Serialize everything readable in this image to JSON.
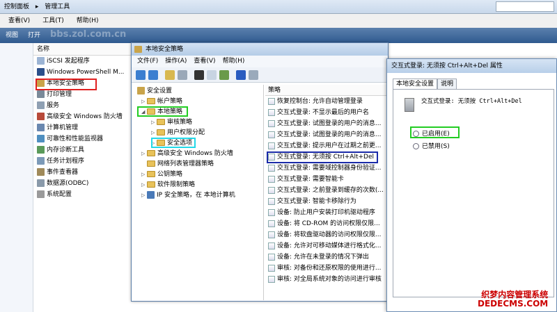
{
  "explorer": {
    "breadcrumb": [
      "控制面板",
      "管理工具"
    ],
    "menu": [
      "查看(V)",
      "工具(T)",
      "帮助(H)"
    ],
    "toolbar": [
      "视图",
      "打开"
    ],
    "watermark": "bbs.zol.com.cn",
    "list_header": "名称",
    "items": [
      "iSCSI 发起程序",
      "Windows PowerShell M...",
      "本地安全策略",
      "打印管理",
      "服务",
      "高级安全 Windows 防火墙",
      "计算机管理",
      "可靠性和性能监视器",
      "内存诊断工具",
      "任务计划程序",
      "事件查看器",
      "数据源(ODBC)",
      "系统配置"
    ]
  },
  "lsp": {
    "title": "本地安全策略",
    "menu": [
      "文件(F)",
      "操作(A)",
      "查看(V)",
      "帮助(H)"
    ],
    "tree": {
      "root": "安全设置",
      "account": "帐户策略",
      "local": "本地策略",
      "audit": "审核策略",
      "rights": "用户权限分配",
      "security": "安全选项",
      "firewall": "高级安全 Windows 防火墙",
      "netlist": "网络列表管理器策略",
      "pubkey": "公钥策略",
      "software": "软件限制策略",
      "ipsec": "IP 安全策略，在 本地计算机"
    },
    "column": "策略",
    "policies": [
      "恢复控制台: 允许自动管理登录",
      "交互式登录: 不显示最后的用户名",
      "交互式登录: 试图登录的用户的消息...",
      "交互式登录: 试图登录的用户的消息...",
      "交互式登录: 提示用户在过期之前更...",
      "交互式登录: 无须按 Ctrl+Alt+Del",
      "交互式登录: 需要域控制器身份验证...",
      "交互式登录: 需要智能卡",
      "交互式登录: 之前登录到缓存的次数(...",
      "交互式登录: 智能卡移除行为",
      "设备: 防止用户安装打印机驱动程序",
      "设备: 将 CD-ROM 的访问权限仅限...",
      "设备: 将软盘驱动器的访问权限仅限...",
      "设备: 允许对可移动媒体进行格式化...",
      "设备: 允许在未登录的情况下弹出",
      "审核: 对备份和还原权限的使用进行...",
      "审核: 对全局系统对象的访问进行审核"
    ]
  },
  "props": {
    "title": "交互式登录: 无须按 Ctrl+Alt+Del 属性",
    "tab_local": "本地安全设置",
    "tab_explain": "说明",
    "policy_name": "交互式登录: 无须按 Ctrl+Alt+Del",
    "enabled": "已启用(E)",
    "disabled": "已禁用(S)",
    "selected": "enabled"
  },
  "watermark2": {
    "line1": "织梦内容管理系统",
    "line2": "DEDECMS.COM"
  },
  "colors": {
    "highlight_red": "#e02020",
    "highlight_green": "#22cc22",
    "highlight_cyan": "#22d8e8",
    "highlight_blue": "#1a2aa8"
  }
}
